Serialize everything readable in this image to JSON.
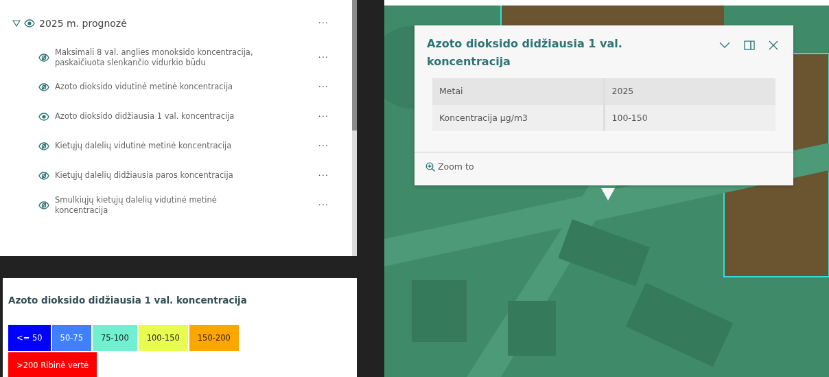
{
  "layer_list": {
    "group": {
      "title": "2025 m. prognozė",
      "expanded": true,
      "visible": true,
      "menu": "···",
      "children": [
        {
          "title": "Maksimali 8 val. anglies monoksido koncentracija, paskaičiuota slenkančio vidurkio būdu",
          "visible": false,
          "menu": "···"
        },
        {
          "title": "Azoto dioksido vidutinė metinė koncentracija",
          "visible": false,
          "menu": "···"
        },
        {
          "title": "Azoto dioksido didžiausia 1 val. koncentracija",
          "visible": true,
          "menu": "···"
        },
        {
          "title": "Kietųjų dalelių vidutinė metinė koncentracija",
          "visible": false,
          "menu": "···"
        },
        {
          "title": "Kietųjų dalelių didžiausia paros koncentracija",
          "visible": false,
          "menu": "···"
        },
        {
          "title": "Smulkiųjų kietųjų dalelių vidutinė metinė koncentracija",
          "visible": false,
          "menu": "···"
        }
      ]
    }
  },
  "legend": {
    "title": "Azoto dioksido didžiausia 1 val. koncentracija",
    "items": [
      {
        "label": "<= 50",
        "color": "#0000ff"
      },
      {
        "label": "50-75",
        "color": "#4080ff"
      },
      {
        "label": "75-100",
        "color": "#70f0d0"
      },
      {
        "label": "100-150",
        "color": "#e8fc50"
      },
      {
        "label": "150-200",
        "color": "#ffa500"
      },
      {
        "label": ">200 Ribinė vertė",
        "color": "#ff0000"
      }
    ]
  },
  "popup": {
    "title": "Azoto dioksido didžiausia 1 val. koncentracija",
    "rows": [
      {
        "field": "Metai",
        "value": "2025"
      },
      {
        "field": "Koncentracija µg/m3",
        "value": "100-150"
      }
    ],
    "action": "Zoom to"
  }
}
